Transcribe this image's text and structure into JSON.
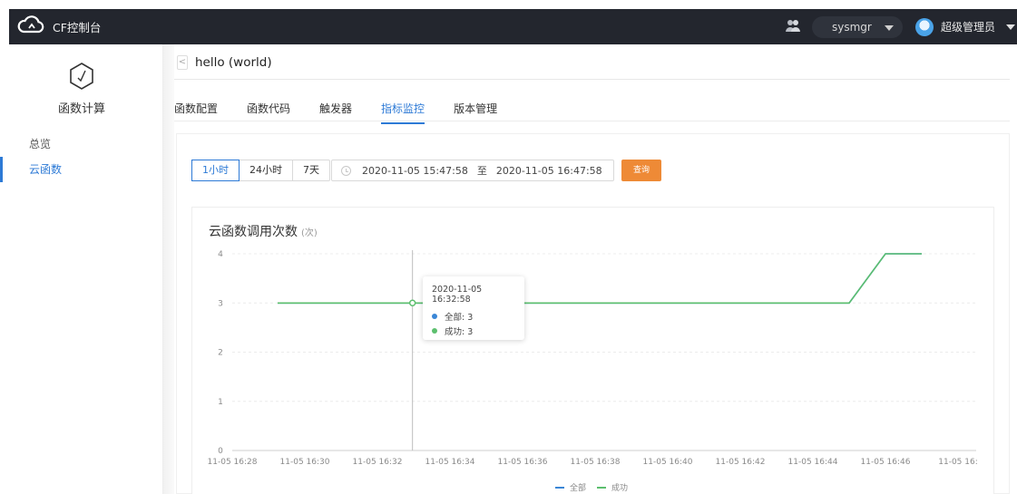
{
  "topbar": {
    "title": "CF控制台",
    "org_name": "sysmgr",
    "user_role": "超级管理员"
  },
  "sidebar": {
    "product_title": "函数计算",
    "items": [
      {
        "label": "总览",
        "active": false
      },
      {
        "label": "云函数",
        "active": true
      }
    ]
  },
  "header": {
    "back_glyph": "<",
    "page_title": "hello (world)"
  },
  "tabs": [
    {
      "label": "函数配置",
      "active": false
    },
    {
      "label": "函数代码",
      "active": false
    },
    {
      "label": "触发器",
      "active": false
    },
    {
      "label": "指标监控",
      "active": true
    },
    {
      "label": "版本管理",
      "active": false
    }
  ],
  "filters": {
    "ranges": [
      {
        "label": "1小时",
        "active": true
      },
      {
        "label": "24小时",
        "active": false
      },
      {
        "label": "7天",
        "active": false
      }
    ],
    "start_time": "2020-11-05 15:47:58",
    "separator": "至",
    "end_time": "2020-11-05 16:47:58",
    "query_label": "查询"
  },
  "colors": {
    "accent": "#2d7ad6",
    "query_button": "#ee8a36",
    "series_all": "#3a86d6",
    "series_success": "#5cbf6e",
    "topbar": "#23262e"
  },
  "tooltip": {
    "time": "2020-11-05 16:32:58",
    "rows": [
      {
        "label": "全部: 3",
        "series": "全部"
      },
      {
        "label": "成功: 3",
        "series": "成功"
      }
    ]
  },
  "chart_data": {
    "type": "line",
    "title": "云函数调用次数",
    "unit": "(次)",
    "x": [
      "11-05 16:28",
      "11-05 16:30",
      "11-05 16:32",
      "11-05 16:34",
      "11-05 16:36",
      "11-05 16:38",
      "11-05 16:40",
      "11-05 16:42",
      "11-05 16:44",
      "11-05 16:45",
      "11-05 16:46",
      "11-05 16:47"
    ],
    "x_tick_labels": [
      "11-05 16:28",
      "11-05 16:30",
      "11-05 16:32",
      "11-05 16:34",
      "11-05 16:36",
      "11-05 16:38",
      "11-05 16:40",
      "11-05 16:42",
      "11-05 16:44",
      "11-05 16:46",
      "11-05 16:"
    ],
    "y_ticks": [
      0,
      1,
      2,
      3,
      4
    ],
    "ylim": [
      0,
      4
    ],
    "grid": true,
    "legend": "bottom",
    "series": [
      {
        "name": "全部",
        "values": [
          3,
          3,
          3,
          3,
          3,
          3,
          3,
          3,
          3,
          3,
          4,
          4
        ]
      },
      {
        "name": "成功",
        "values": [
          3,
          3,
          3,
          3,
          3,
          3,
          3,
          3,
          3,
          3,
          4,
          4
        ]
      }
    ],
    "hover_x": "11-05 16:32:58"
  }
}
